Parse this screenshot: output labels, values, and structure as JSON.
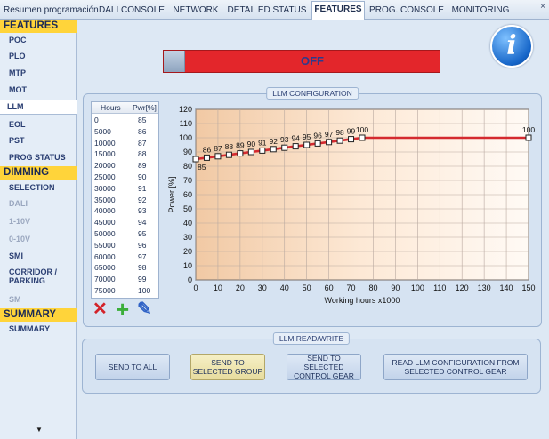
{
  "tabs": [
    {
      "label": "Resumen programación",
      "active": false
    },
    {
      "label": "DALI CONSOLE",
      "active": false
    },
    {
      "label": "NETWORK",
      "active": false
    },
    {
      "label": "DETAILED STATUS",
      "active": false
    },
    {
      "label": "FEATURES",
      "active": true
    },
    {
      "label": "PROG. CONSOLE",
      "active": false
    },
    {
      "label": "MONITORING",
      "active": false
    }
  ],
  "tab_close_label": "×",
  "sidebar": {
    "features_header": "FEATURES",
    "features_items": [
      "POC",
      "PLO",
      "MTP",
      "MOT",
      "LLM",
      "EOL",
      "PST",
      "PROG STATUS"
    ],
    "selected_item": "LLM",
    "dimming_header": "DIMMING",
    "dimming_items": [
      "SELECTION",
      "DALI",
      "1-10V",
      "0-10V",
      "SMI",
      "CORRIDOR / PARKING",
      "SM"
    ],
    "dimming_disabled": [
      "DALI",
      "1-10V",
      "0-10V",
      "SM"
    ],
    "summary_header": "SUMMARY",
    "summary_items": [
      "SUMMARY"
    ],
    "scroll_arrow": "▼"
  },
  "status": {
    "label": "OFF",
    "color": "#e3262b"
  },
  "info_icon_glyph": "i",
  "llm_config": {
    "title": "LLM CONFIGURATION",
    "table": {
      "headers": [
        "Hours",
        "Pwr[%]"
      ],
      "rows": [
        [
          "0",
          "85"
        ],
        [
          "5000",
          "86"
        ],
        [
          "10000",
          "87"
        ],
        [
          "15000",
          "88"
        ],
        [
          "20000",
          "89"
        ],
        [
          "25000",
          "90"
        ],
        [
          "30000",
          "91"
        ],
        [
          "35000",
          "92"
        ],
        [
          "40000",
          "93"
        ],
        [
          "45000",
          "94"
        ],
        [
          "50000",
          "95"
        ],
        [
          "55000",
          "96"
        ],
        [
          "60000",
          "97"
        ],
        [
          "65000",
          "98"
        ],
        [
          "70000",
          "99"
        ],
        [
          "75000",
          "100"
        ]
      ]
    },
    "icons": [
      "delete-icon",
      "add-icon",
      "edit-icon"
    ],
    "icon_glyphs": {
      "delete": "✕",
      "add": "+",
      "edit": "✎"
    }
  },
  "chart_data": {
    "type": "line",
    "xlabel": "Working hours x1000",
    "ylabel": "Power [%]",
    "xlim": [
      0,
      150
    ],
    "ylim": [
      0,
      120
    ],
    "xticks": [
      0,
      10,
      20,
      30,
      40,
      50,
      60,
      70,
      80,
      90,
      100,
      110,
      120,
      130,
      140,
      150
    ],
    "yticks": [
      0,
      10,
      20,
      30,
      40,
      50,
      60,
      70,
      80,
      90,
      100,
      110,
      120
    ],
    "grid": true,
    "series": [
      {
        "color": "#d42a2f",
        "x": [
          0,
          5,
          10,
          15,
          20,
          25,
          30,
          35,
          40,
          45,
          50,
          55,
          60,
          65,
          70,
          75,
          150
        ],
        "y": [
          85,
          86,
          87,
          88,
          89,
          90,
          91,
          92,
          93,
          94,
          95,
          96,
          97,
          98,
          99,
          100,
          100
        ]
      }
    ]
  },
  "llm_rw": {
    "title": "LLM READ/WRITE",
    "buttons": [
      {
        "label": "SEND TO ALL",
        "highlighted": false
      },
      {
        "label": "SEND TO\nSELECTED GROUP",
        "highlighted": true
      },
      {
        "label": "SEND TO\nSELECTED\nCONTROL GEAR",
        "highlighted": false
      },
      {
        "label": "READ LLM CONFIGURATION FROM\nSELECTED CONTROL GEAR",
        "highlighted": false
      }
    ]
  }
}
